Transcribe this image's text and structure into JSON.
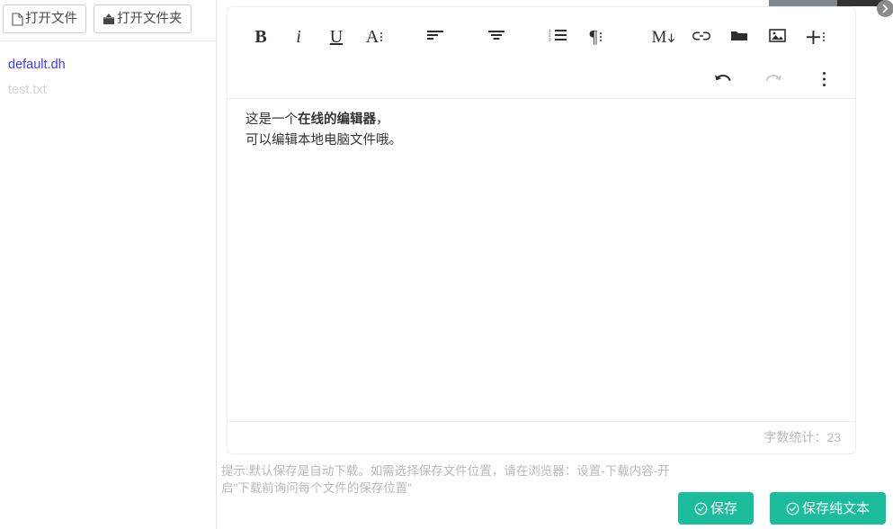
{
  "topbar": {
    "scroll_arrow_icon": "chevron-right-circle-icon"
  },
  "sidebar": {
    "buttons": [
      {
        "label": "打开文件",
        "icon": "file-icon"
      },
      {
        "label": "打开文件夹",
        "icon": "folder-upload-icon"
      }
    ],
    "files": [
      {
        "name": "default.dh",
        "state": "active"
      },
      {
        "name": "test.txt",
        "state": "muted"
      }
    ]
  },
  "editor": {
    "toolbar_row1": [
      {
        "name": "bold-button",
        "icon": "bold-icon",
        "glyph": "B"
      },
      {
        "name": "italic-button",
        "icon": "italic-icon",
        "glyph": "i"
      },
      {
        "name": "underline-button",
        "icon": "underline-icon",
        "glyph": "U"
      },
      {
        "name": "font-style-button",
        "icon": "font-size-icon",
        "glyph": "A"
      },
      {
        "name": "align-left-button",
        "icon": "align-left-icon",
        "glyph": ""
      },
      {
        "name": "align-center-button",
        "icon": "align-center-icon",
        "glyph": ""
      },
      {
        "name": "ordered-list-button",
        "icon": "ordered-list-icon",
        "glyph": ""
      },
      {
        "name": "paragraph-button",
        "icon": "paragraph-icon",
        "glyph": "¶"
      },
      {
        "name": "markdown-button",
        "icon": "markdown-icon",
        "glyph": "M"
      },
      {
        "name": "link-button",
        "icon": "link-icon",
        "glyph": ""
      },
      {
        "name": "folder-button",
        "icon": "folder-icon",
        "glyph": ""
      },
      {
        "name": "image-button",
        "icon": "image-icon",
        "glyph": ""
      },
      {
        "name": "insert-more-button",
        "icon": "plus-icon",
        "glyph": "+"
      }
    ],
    "toolbar_row2": [
      {
        "name": "undo-button",
        "icon": "undo-icon",
        "disabled": false
      },
      {
        "name": "redo-button",
        "icon": "redo-icon",
        "disabled": true
      },
      {
        "name": "more-menu-button",
        "icon": "more-vertical-icon",
        "disabled": false
      }
    ],
    "content": {
      "line1_part1": "这是一个",
      "line1_bold": "在线的编辑器",
      "line1_part2": "，",
      "line2": "可以编辑本地电脑文件哦。"
    },
    "word_count_label": "字数统计：23"
  },
  "hint": "提示:默认保存是自动下载。如需选择保存文件位置，请在浏览器：设置-下载内容-开启\"下载前询问每个文件的保存位置\"",
  "actions": [
    {
      "label": "保存",
      "icon": "check-circle-icon"
    },
    {
      "label": "保存纯文本",
      "icon": "check-circle-icon"
    }
  ],
  "colors": {
    "accent_teal": "#1abc9c",
    "active_file_blue": "#3b3bff",
    "muted_gray": "#d2d2d2",
    "topbar_gray": "#7f8690",
    "topbar_dark": "#333333"
  }
}
